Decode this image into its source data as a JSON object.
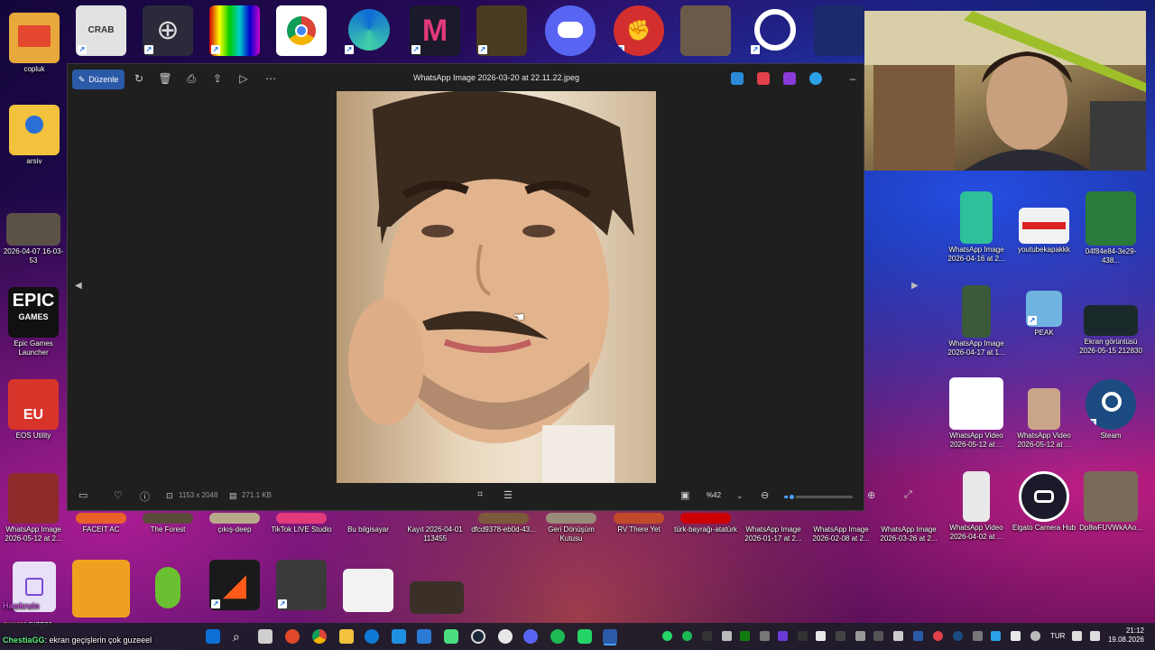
{
  "desktop_left": [
    {
      "label": "copluk",
      "color": "#e4482e"
    },
    {
      "label": "arsiv",
      "color": "#f2c23d"
    },
    {
      "label": "2026-04-07 16-03-53",
      "color": "#5b5247"
    },
    {
      "label": "Epic Games Launcher",
      "color": "#111111"
    },
    {
      "label": "EOS Utility",
      "color": "#d8352a"
    },
    {
      "label": "WhatsApp Image 2026-05-12 at 2...",
      "color": "#8d2b2b"
    }
  ],
  "desktop_top": [
    {
      "label": "",
      "color": "#e2e2e2"
    },
    {
      "label": "",
      "color": "#2a2a3a"
    },
    {
      "label": "",
      "color": "#3a3a3a"
    },
    {
      "label": "",
      "color": "#ffffff"
    },
    {
      "label": "",
      "color": "#0f6bd6"
    },
    {
      "label": "",
      "color": "#1a1a2a"
    },
    {
      "label": "",
      "color": "#4a3a20"
    },
    {
      "label": "",
      "color": "#5865f2"
    },
    {
      "label": "",
      "color": "#d32f2f"
    },
    {
      "label": "",
      "color": "#6b5a4a"
    },
    {
      "label": "",
      "color": "#1b2a6b"
    }
  ],
  "desktop_right": [
    {
      "label": "WhatsApp Image 2026-04-16 at 2...",
      "color": "#2fbf9a"
    },
    {
      "label": "youtubekapakkk",
      "color": "#f2f2f2"
    },
    {
      "label": "04f84e84-3e29-438...",
      "color": "#2a7a3a"
    },
    {
      "label": "WhatsApp Image 2026-04-17 at 1...",
      "color": "#3a5a3a"
    },
    {
      "label": "PEAK",
      "color": "#6fb3e0"
    },
    {
      "label": "Ekran görüntüsü 2026-05-15 212830",
      "color": "#1a2a2a"
    },
    {
      "label": "WhatsApp Video 2026-05-12 at ...",
      "color": "#ffffff"
    },
    {
      "label": "WhatsApp Video 2026-05-12 at ...",
      "color": "#c9a58a"
    },
    {
      "label": "Steam",
      "color": "#1b4b80"
    },
    {
      "label": "WhatsApp Video 2026-04-02 at ...",
      "color": "#e8e8e8"
    },
    {
      "label": "Elgato Camera Hub",
      "color": "#1a1a2a"
    },
    {
      "label": "Dp8wFUVWkAAo...",
      "color": "#7a6a5a"
    }
  ],
  "desktop_bottom_row": [
    {
      "label": "FACEIT AC"
    },
    {
      "label": "The Forest"
    },
    {
      "label": "çıkış-deep"
    },
    {
      "label": "TikTok LIVE Studio"
    },
    {
      "label": "Bu bilgisayar"
    },
    {
      "label": "Kayıt 2026-04-01 113455"
    },
    {
      "label": "dfcd9378-eb0d-43..."
    },
    {
      "label": "Geri Dönüşüm Kutusu"
    },
    {
      "label": "RV There Yet"
    },
    {
      "label": "türk-bayrağı-atatürk"
    },
    {
      "label": "WhatsApp Image 2026-01-17 at 2..."
    },
    {
      "label": "WhatsApp Image 2026-02-08 at 2..."
    },
    {
      "label": "WhatsApp Image 2026-03-26 at 2..."
    }
  ],
  "viewer": {
    "edit_label": "Düzenle",
    "title": "WhatsApp Image 2026-03-20 at 22.11.22.jpeg",
    "dimensions": "1153 x 2048",
    "filesize": "271.1 KB",
    "zoom": "%42",
    "zoom_fraction": 0.1
  },
  "chat": {
    "line1_user": "Hawkruin",
    "line2_user": "ayers",
    "line2_text": ": ruzgar",
    "line3_user": "ChestiaGG",
    "line3_text": ": ekran geçişlerin çok guzeeel"
  },
  "taskbar": {
    "lang": "TUR",
    "time": "21:12",
    "date": "19.08.2026",
    "app_colors": [
      "#0b6fd6",
      "#ffffff",
      "#cfcfcf",
      "#e04a2a",
      "#34a853",
      "#f2c23d",
      "#0f7bd6",
      "#1f8fe0",
      "#2a7ad6",
      "#4ade80",
      "#1b2838",
      "#e8e8e8",
      "#5865f2",
      "#1db954",
      "#25d366",
      "#2b5aa8"
    ]
  }
}
